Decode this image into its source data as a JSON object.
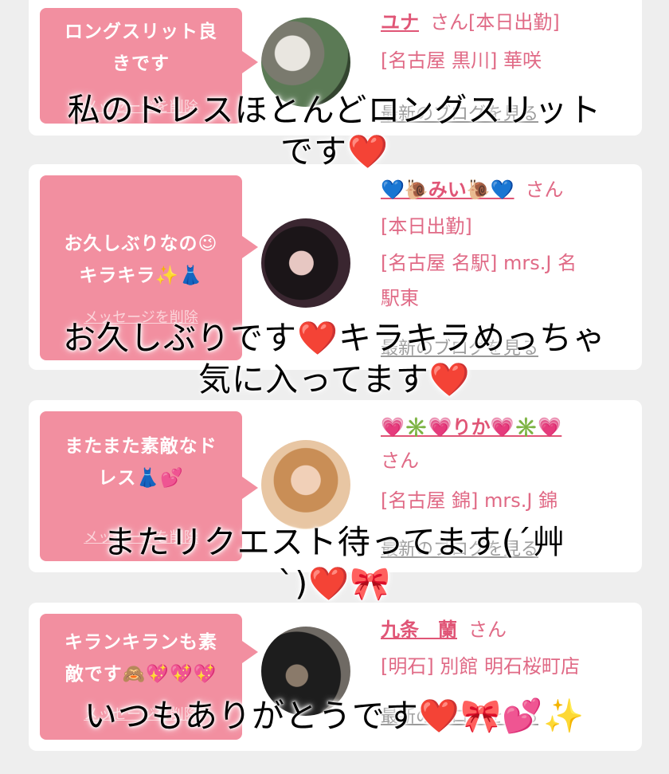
{
  "cards": [
    {
      "bubble_lines": [
        "ロングスリット良",
        "きです"
      ],
      "delete_label": "メッセージを削除",
      "name": "ユナ",
      "san": "さん",
      "status": "[本日出勤]",
      "location_lines": [
        "[名古屋 黒川] 華咲"
      ],
      "blog_label": "最新のブログを見る"
    },
    {
      "bubble_lines": [
        "お久しぶりなの😉",
        "キラキラ✨👗"
      ],
      "delete_label": "メッセージを削除",
      "name": "💙🐌みい🐌💙",
      "san": "さん",
      "status": "[本日出勤]",
      "location_lines": [
        "[名古屋 名駅] mrs.J 名",
        "駅東"
      ],
      "blog_label": "最新のブログを見る"
    },
    {
      "bubble_lines": [
        "またまた素敵なド",
        "レス👗💕"
      ],
      "delete_label": "メッセージを削除",
      "name": "💗✳️💗りか💗✳️💗",
      "san": "さん",
      "status": "",
      "location_lines": [
        "[名古屋 錦] mrs.J 錦"
      ],
      "blog_label": "最新のブログを見る"
    },
    {
      "bubble_lines": [
        "キランキランも素",
        "敵です🙈💖💖💖"
      ],
      "delete_label": "メッセージを削除",
      "name": "九条　蘭",
      "san": "さん",
      "status": "",
      "location_lines": [
        "[明石] 別館 明石桜町店"
      ],
      "blog_label": "最新のブログを見る"
    }
  ],
  "captions": [
    {
      "lines": [
        "私のドレスほとんどロングスリット",
        "です❤️"
      ]
    },
    {
      "lines": [
        "お久しぶりです❤️キラキラめっちゃ",
        "気に入ってます❤️"
      ]
    },
    {
      "lines": [
        "またリクエスト待ってます(´艸",
        "`)❤️🎀"
      ]
    },
    {
      "lines": [
        "いつもありがとうです❤️🎀💕✨"
      ]
    }
  ],
  "colors": {
    "bubble": "#f28fa0",
    "name": "#e05576",
    "info": "#e06a86",
    "link": "#9a9a9a",
    "background": "#eeeeee"
  }
}
